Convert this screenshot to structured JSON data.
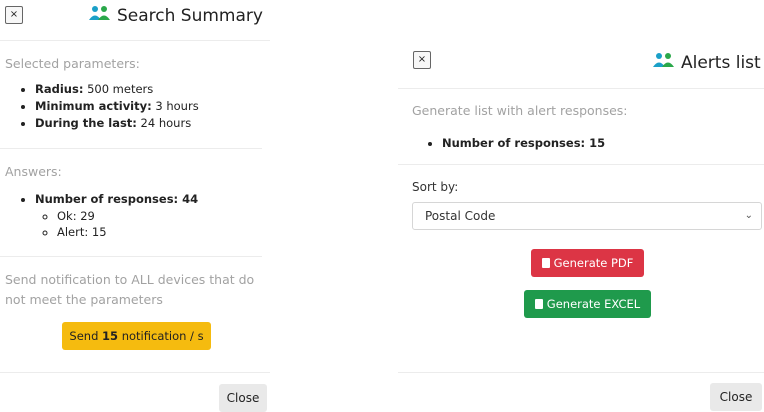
{
  "summary": {
    "close_icon": "×",
    "title": "Search Summary",
    "selected_label": "Selected parameters:",
    "params": [
      {
        "key": "Radius:",
        "value": " 500 meters"
      },
      {
        "key": "Minimum activity:",
        "value": " 3 hours"
      },
      {
        "key": "During the last:",
        "value": " 24 hours"
      }
    ],
    "answers_label": "Answers:",
    "responses_label": "Number of responses: 44",
    "sub": [
      {
        "text": "Ok: 29"
      },
      {
        "text": "Alert: 15"
      }
    ],
    "notify_line1": "Send notification to ALL devices that do",
    "notify_line2": "not meet the parameters",
    "send_prefix": "Send ",
    "send_count": "15",
    "send_suffix": " notification / s",
    "close_label": "Close"
  },
  "alerts": {
    "close_icon": "×",
    "title": "Alerts list",
    "generate_label": "Generate list with alert responses:",
    "responses_label": "Number of responses: 15",
    "sort_label": "Sort by:",
    "sort_value": "Postal Code",
    "pdf_label": "Generate PDF",
    "excel_label": "Generate EXCEL",
    "close_label": "Close"
  },
  "icons": {
    "users": "users-icon",
    "pdf": "pdf-file-icon",
    "excel": "excel-file-icon"
  },
  "colors": {
    "warning": "#f5bb0f",
    "danger": "#dc3545",
    "success": "#1f9a4c",
    "users_icon": "#1aa0c8"
  }
}
